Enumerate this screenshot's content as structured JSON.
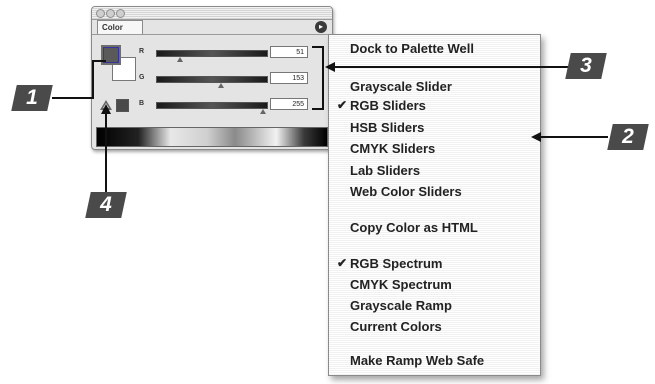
{
  "palette": {
    "tab_label": "Color",
    "menu_button_icon": "circle-arrow-icon",
    "rows": [
      {
        "label": "R",
        "value": "51",
        "slider_fraction": 0.2
      },
      {
        "label": "G",
        "value": "153",
        "slider_fraction": 0.6
      },
      {
        "label": "B",
        "value": "255",
        "slider_fraction": 1.0
      }
    ]
  },
  "menu": {
    "items": [
      {
        "label": "Dock to Palette Well",
        "checked": false
      },
      {
        "label": "Grayscale Slider",
        "checked": false
      },
      {
        "label": "RGB Sliders",
        "checked": true
      },
      {
        "label": "HSB Sliders",
        "checked": false
      },
      {
        "label": "CMYK Sliders",
        "checked": false
      },
      {
        "label": "Lab Sliders",
        "checked": false
      },
      {
        "label": "Web Color Sliders",
        "checked": false
      },
      {
        "label": "Copy Color as HTML",
        "checked": false
      },
      {
        "label": "RGB Spectrum",
        "checked": true
      },
      {
        "label": "CMYK Spectrum",
        "checked": false
      },
      {
        "label": "Grayscale Ramp",
        "checked": false
      },
      {
        "label": "Current Colors",
        "checked": false
      },
      {
        "label": "Make Ramp Web Safe",
        "checked": false
      }
    ],
    "check_glyph": "✔"
  },
  "callouts": {
    "c1": "1",
    "c2": "2",
    "c3": "3",
    "c4": "4"
  }
}
